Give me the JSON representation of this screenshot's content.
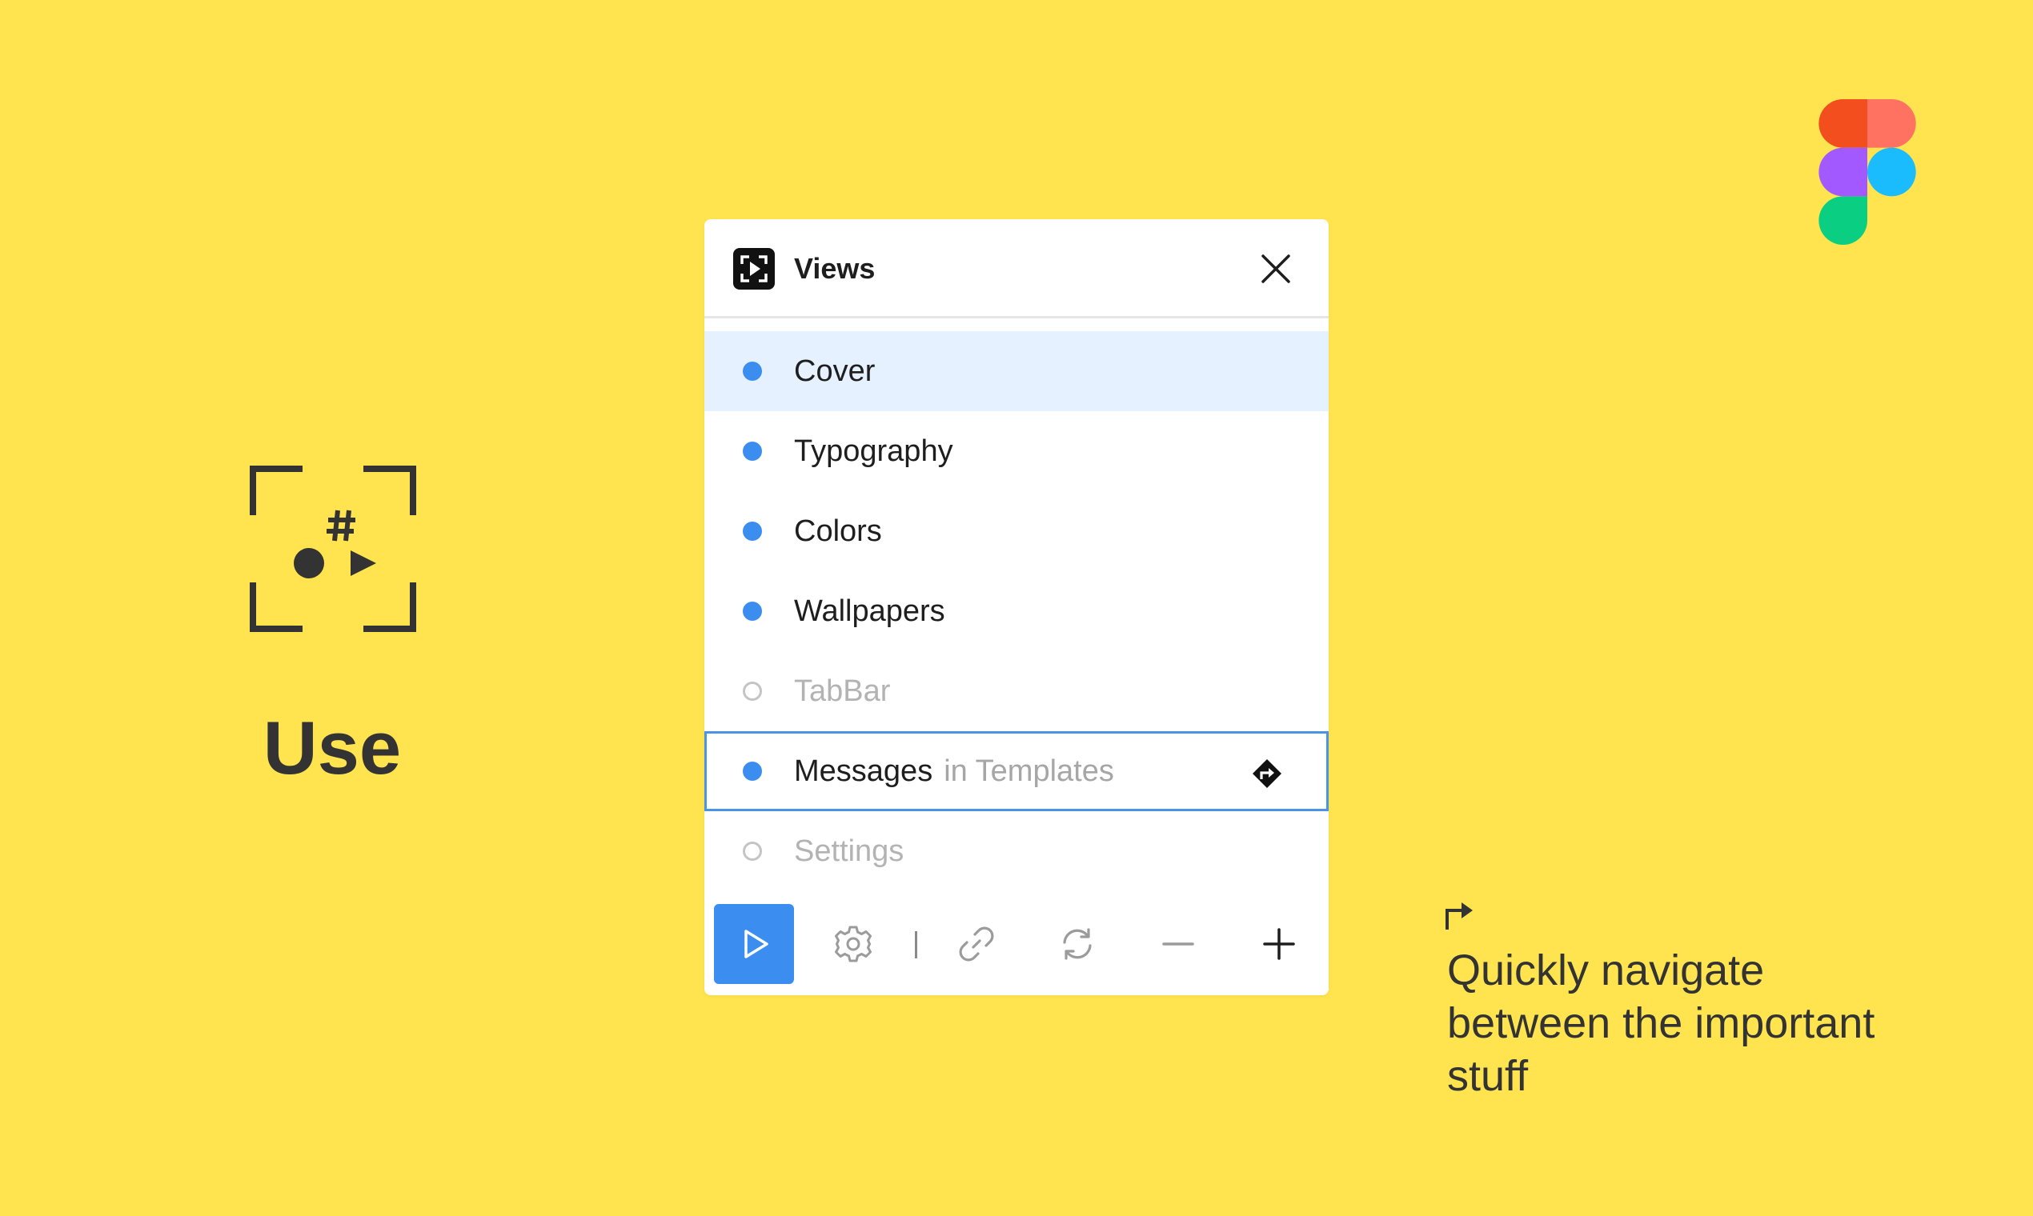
{
  "brand": {
    "label": "Use",
    "background": "#FFE44F",
    "accent": "#3B8EF0"
  },
  "panel": {
    "title": "Views",
    "items": [
      {
        "label": "Cover",
        "context": "",
        "active": true,
        "state": "selected"
      },
      {
        "label": "Typography",
        "context": "",
        "active": true,
        "state": "normal"
      },
      {
        "label": "Colors",
        "context": "",
        "active": true,
        "state": "normal"
      },
      {
        "label": "Wallpapers",
        "context": "",
        "active": true,
        "state": "normal"
      },
      {
        "label": "TabBar",
        "context": "",
        "active": false,
        "state": "normal"
      },
      {
        "label": "Messages",
        "context": "in Templates",
        "active": true,
        "state": "focused"
      },
      {
        "label": "Settings",
        "context": "",
        "active": false,
        "state": "normal"
      }
    ],
    "toolbar": [
      "play-icon",
      "gear-icon",
      "link-icon",
      "refresh-icon",
      "minus-icon",
      "plus-icon"
    ]
  },
  "callout": {
    "lines": [
      "Quickly navigate",
      "between the important",
      "stuff"
    ]
  }
}
